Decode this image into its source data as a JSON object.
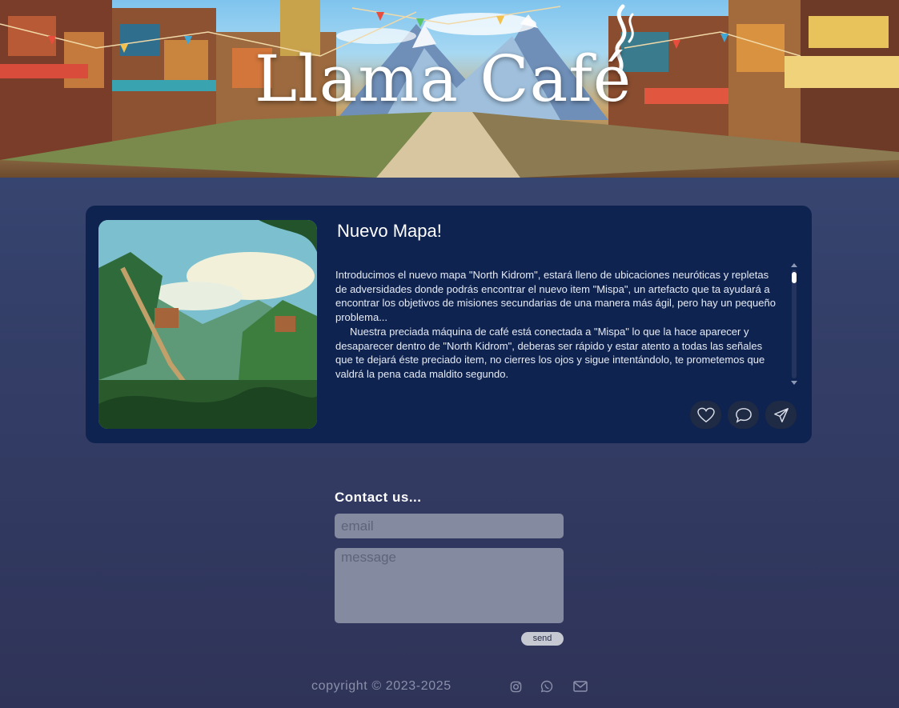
{
  "header": {
    "logo_text": "Llama Café"
  },
  "post": {
    "title": "Nuevo Mapa!",
    "paragraphs": [
      "Introducimos el nuevo mapa \"North Kidrom\", estará lleno de ubicaciones neuróticas y repletas de adversidades donde podrás encontrar el nuevo item \"Mispa\", un artefacto que ta ayudará a encontrar los objetivos de misiones secundarias de una manera más ágil, pero hay un pequeño problema...",
      "Nuestra preciada máquina de café está conectada a \"Mispa\" lo que la hace aparecer y desaparecer dentro de \"North Kidrom\", deberas ser rápido y estar atento a todas las señales que te dejará éste preciado item, no cierres los ojos y sigue intentándolo, te prometemos que valdrá la pena cada maldito segundo."
    ],
    "actions": {
      "like_icon": "heart-icon",
      "comment_icon": "comment-icon",
      "share_icon": "send-icon"
    }
  },
  "contact": {
    "title": "Contact us...",
    "email_placeholder": "email",
    "message_placeholder": "message",
    "send_label": "send"
  },
  "footer": {
    "copyright": "copyright © 2023-2025",
    "icons": [
      "instagram-icon",
      "whatsapp-icon",
      "mail-icon"
    ]
  },
  "colors": {
    "background_top": "#3a4d78",
    "background_bottom": "#2f3358",
    "card": "#0f2350",
    "field": "#848aa0",
    "button": "#c6c9d2"
  }
}
